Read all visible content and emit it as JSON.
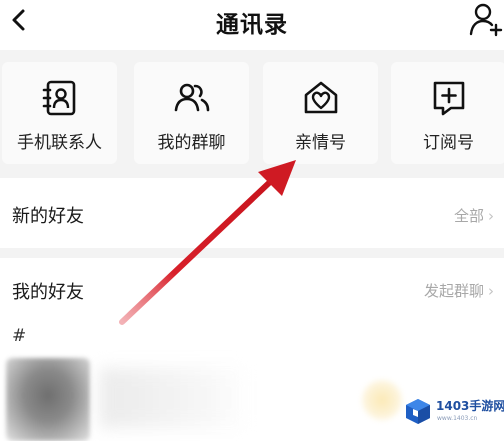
{
  "header": {
    "title": "通讯录",
    "back_icon": "back-arrow-icon",
    "add_icon": "add-friend-icon"
  },
  "tiles": [
    {
      "label": "手机联系人",
      "icon": "phone-contacts-icon"
    },
    {
      "label": "我的群聊",
      "icon": "group-chat-icon"
    },
    {
      "label": "亲情号",
      "icon": "family-number-icon"
    },
    {
      "label": "订阅号",
      "icon": "subscription-icon"
    }
  ],
  "new_friends": {
    "label": "新的好友",
    "action": "全部",
    "chevron": "›"
  },
  "my_friends": {
    "label": "我的好友",
    "action": "发起群聊",
    "chevron": "›"
  },
  "section_letter": "#",
  "watermark": {
    "name": "1403手游网",
    "url": "www.1403.cn"
  },
  "colors": {
    "accent_arrow": "#d8202a",
    "background_gray": "#f3f3f3",
    "muted_text": "#a8a8a8",
    "watermark_blue": "#1f4fa0"
  }
}
